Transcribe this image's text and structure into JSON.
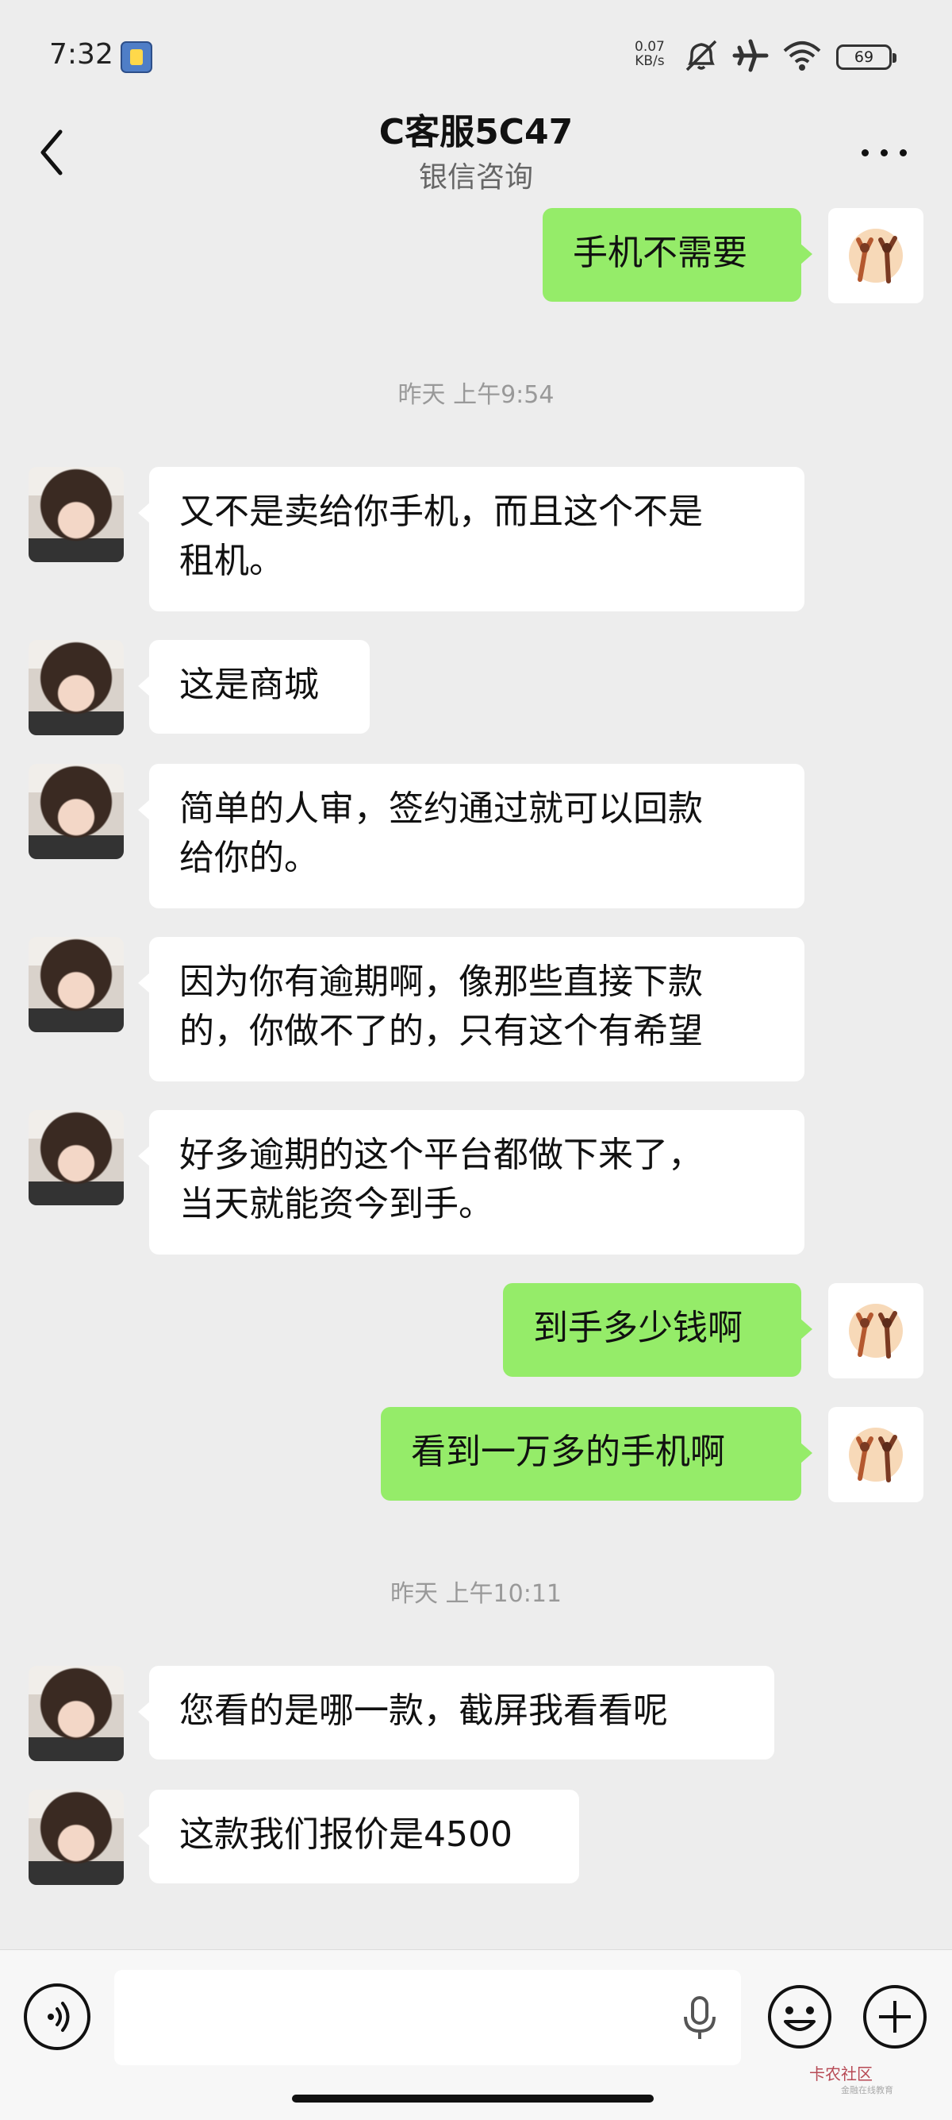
{
  "status_bar": {
    "time": "7:32",
    "net_speed_value": "0.07",
    "net_speed_unit": "KB/s",
    "battery": "69"
  },
  "header": {
    "title": "C客服5C47",
    "subtitle": "银信咨询",
    "back_icon": "chevron-left-icon",
    "more_icon": "more-horizontal-icon"
  },
  "messages": [
    {
      "side": "out",
      "text": "手机不需要"
    },
    {
      "type": "timestamp",
      "text": "昨天 上午9:54"
    },
    {
      "side": "in",
      "text": "又不是卖给你手机，而且这个不是\n租机。"
    },
    {
      "side": "in",
      "text": "这是商城"
    },
    {
      "side": "in",
      "text": "简单的人审，签约通过就可以回款\n给你的。"
    },
    {
      "side": "in",
      "text": "因为你有逾期啊，像那些直接下款\n的，你做不了的，只有这个有希望"
    },
    {
      "side": "in",
      "text": "好多逾期的这个平台都做下来了，\n当天就能资今到手。"
    },
    {
      "side": "out",
      "text": "到手多少钱啊"
    },
    {
      "side": "out",
      "text": "看到一万多的手机啊"
    },
    {
      "type": "timestamp",
      "text": "昨天 上午10:11"
    },
    {
      "side": "in",
      "text": "您看的是哪一款，截屏我看看呢"
    },
    {
      "side": "in",
      "text": "这款我们报价是4500"
    }
  ],
  "input_bar": {
    "value": "",
    "voice_icon": "voice-input-icon",
    "mic_icon": "microphone-icon",
    "emoji_icon": "emoji-icon",
    "plus_icon": "plus-icon"
  },
  "watermark": {
    "text": "卡农社区",
    "sub": "金融在线教育"
  },
  "colors": {
    "background": "#ededed",
    "outgoing_bubble": "#95ec69",
    "incoming_bubble": "#ffffff",
    "timestamp_text": "#999999"
  }
}
